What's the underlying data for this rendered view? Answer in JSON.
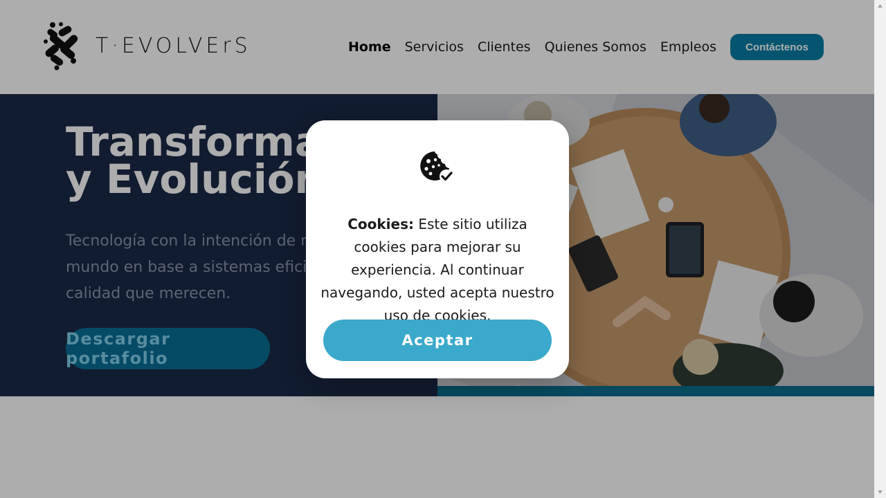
{
  "header": {
    "logo_text": "T·EVOLVErS",
    "nav": [
      {
        "label": "Home",
        "active": true
      },
      {
        "label": "Servicios"
      },
      {
        "label": "Clientes"
      },
      {
        "label": "Quienes Somos"
      },
      {
        "label": "Empleos"
      }
    ],
    "contact_label": "Contáctenos"
  },
  "hero": {
    "title": "Transformación\ny Evolución",
    "subtitle": "Tecnología con la intención de mejorar el mundo en base a sistemas eficientes y con la calidad que merecen.",
    "portfolio_label": "Descargar portafolio"
  },
  "cookie_dialog": {
    "icon": "cookie-check-icon",
    "title": "Cookies:",
    "message": "Este sitio utiliza cookies para mejorar su experiencia. Al continuar navegando, usted acepta nuestro uso de cookies.",
    "accept_label": "Aceptar"
  },
  "colors": {
    "brand_blue": "#0a7ea6",
    "hero_navy": "#1b2a48",
    "accept_blue": "#3aa9cc"
  }
}
